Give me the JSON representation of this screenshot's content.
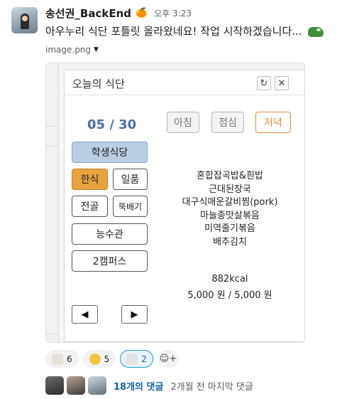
{
  "message": {
    "sender": "송선권_BackEnd",
    "sender_emoji": "🍊",
    "time": "오후 3:23",
    "text": "아우누리 식단 포틀릿 올라왔네요! 작업 시작하겠습니다...",
    "text_emoji": "frog-emoji"
  },
  "file": {
    "name": "image.png",
    "caret": "▼"
  },
  "app": {
    "title": "오늘의 식단",
    "refresh_icon": "↻",
    "close_icon": "✕",
    "date": "05 / 30",
    "meals": [
      "아침",
      "점심",
      "저녁"
    ],
    "selected_meal": "저녁",
    "cafeteria": "학생식당",
    "categories": [
      "한식",
      "일품",
      "전골",
      "뚝배기"
    ],
    "selected_category": "한식",
    "places": [
      "능수관",
      "2캠퍼스"
    ],
    "menu": [
      "혼합잡곡밥&흰밥",
      "근대된장국",
      "대구식매운갈비찜(pork)",
      "마늘종맛살볶음",
      "미역줄기볶음",
      "배추김치"
    ],
    "kcal": "882kcal",
    "price": "5,000 원 / 5,000 원",
    "prev_label": "◀",
    "next_label": "▶"
  },
  "reactions": [
    {
      "emoji": "reaction-emoji-1",
      "count": "6",
      "active": false
    },
    {
      "emoji": "reaction-emoji-2",
      "count": "5",
      "active": false
    },
    {
      "emoji": "reaction-emoji-3",
      "count": "2",
      "active": true
    }
  ],
  "add_reaction_icon": "☺+",
  "thread": {
    "count_label": "18개의 댓글",
    "last_reply": "2개월 전 마지막 댓글"
  },
  "colors": {
    "accent_date": "#4a6fa5",
    "selected_meal": "#e98b3c",
    "selected_category": "#eaa23f",
    "cafeteria": "#b9cde3",
    "link": "#1264a3"
  }
}
